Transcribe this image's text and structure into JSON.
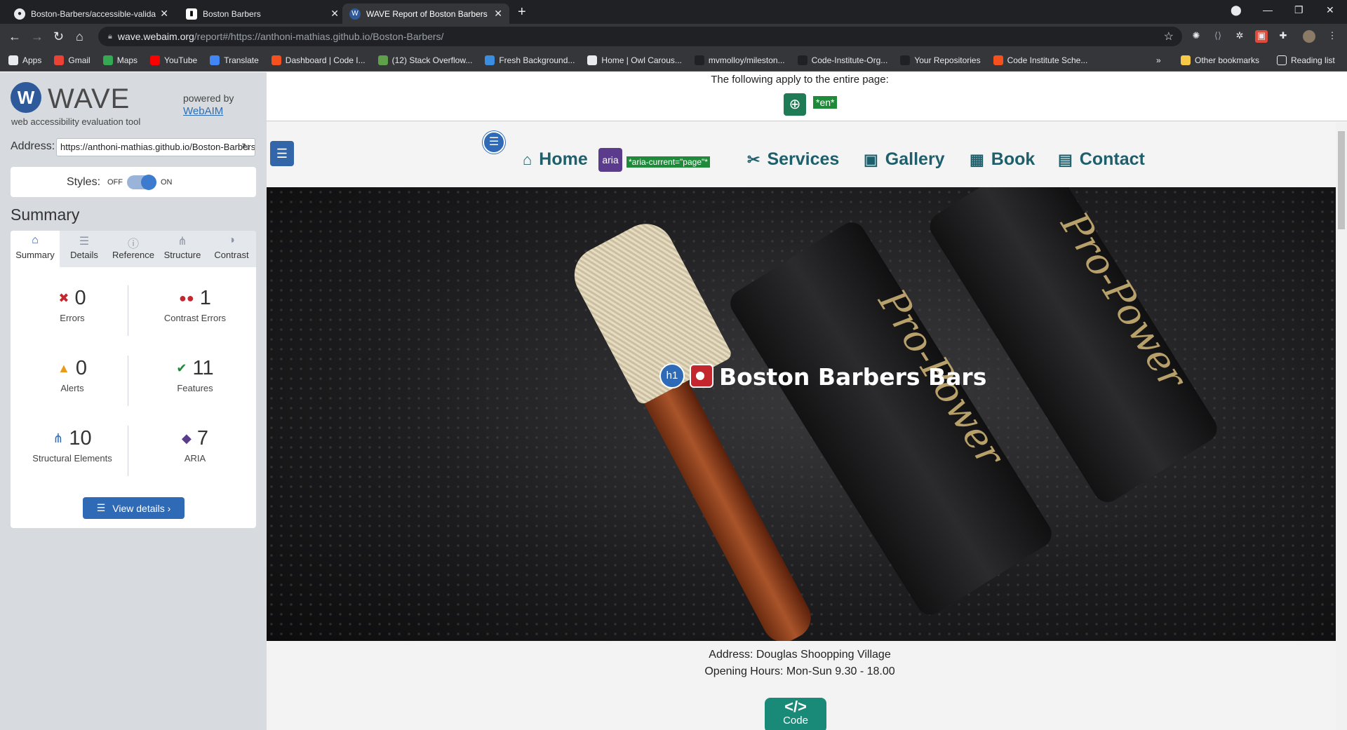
{
  "browser": {
    "tabs": [
      {
        "label": "Boston-Barbers/accessible-valida",
        "active": false
      },
      {
        "label": "Boston Barbers",
        "active": false
      },
      {
        "label": "WAVE Report of Boston Barbers",
        "active": true
      }
    ],
    "url_host": "wave.webaim.org",
    "url_path": "/report#/https://anthoni-mathias.github.io/Boston-Barbers/",
    "bookmarks": [
      {
        "label": "Apps",
        "color": "#e8eaed"
      },
      {
        "label": "Gmail",
        "color": "#ea4335"
      },
      {
        "label": "Maps",
        "color": "#34a853"
      },
      {
        "label": "YouTube",
        "color": "#ff0000"
      },
      {
        "label": "Translate",
        "color": "#4285f4"
      },
      {
        "label": "Dashboard | Code I...",
        "color": "#f4511e"
      },
      {
        "label": "(12) Stack Overflow...",
        "color": "#5fa14a"
      },
      {
        "label": "Fresh Background...",
        "color": "#3b8de0"
      },
      {
        "label": "Home | Owl Carous...",
        "color": "#e8eaed"
      },
      {
        "label": "mvmolloy/mileston...",
        "color": "#202124"
      },
      {
        "label": "Code-Institute-Org...",
        "color": "#202124"
      },
      {
        "label": "Your Repositories",
        "color": "#202124"
      },
      {
        "label": "Code Institute Sche...",
        "color": "#f4511e"
      }
    ],
    "bookmarks_more": "»",
    "other_bookmarks": "Other bookmarks",
    "reading_list": "Reading list"
  },
  "wave": {
    "logo_text": "WAVE",
    "subtitle": "web accessibility evaluation tool",
    "powered_by": "powered by",
    "webaim_link": "WebAIM",
    "address_label": "Address:",
    "address_value": "https://anthoni-mathias.github.io/Boston-Barbers/",
    "styles_label": "Styles:",
    "styles_off": "OFF",
    "styles_on": "ON",
    "styles_enabled": true,
    "summary_heading": "Summary",
    "tabs": [
      {
        "label": "Summary",
        "icon": "home-icon",
        "active": true
      },
      {
        "label": "Details",
        "icon": "list-icon",
        "active": false
      },
      {
        "label": "Reference",
        "icon": "info-icon",
        "active": false
      },
      {
        "label": "Structure",
        "icon": "structure-icon",
        "active": false
      },
      {
        "label": "Contrast",
        "icon": "contrast-icon",
        "active": false
      }
    ],
    "stats": [
      {
        "key": "errors",
        "count": "0",
        "label": "Errors",
        "icon": "error-icon",
        "color": "#c4262e"
      },
      {
        "key": "contrast",
        "count": "1",
        "label": "Contrast Errors",
        "icon": "contrast-error-icon",
        "color": "#c4262e"
      },
      {
        "key": "alerts",
        "count": "0",
        "label": "Alerts",
        "icon": "alert-icon",
        "color": "#e89a1a"
      },
      {
        "key": "features",
        "count": "11",
        "label": "Features",
        "icon": "feature-icon",
        "color": "#1e8a3a"
      },
      {
        "key": "structural",
        "count": "10",
        "label": "Structural Elements",
        "icon": "structure-icon",
        "color": "#2e6ab5"
      },
      {
        "key": "aria",
        "count": "7",
        "label": "ARIA",
        "icon": "aria-icon",
        "color": "#5b3c8c"
      }
    ],
    "view_details": "View details ›"
  },
  "preview": {
    "apply_text": "The following apply to the entire page:",
    "lang_tag": "*en*",
    "nav": [
      {
        "label": "Home",
        "icon": "home-icon"
      },
      {
        "label": "Services",
        "icon": "scissors-icon"
      },
      {
        "label": "Gallery",
        "icon": "image-icon"
      },
      {
        "label": "Book",
        "icon": "calendar-icon"
      },
      {
        "label": "Contact",
        "icon": "contact-icon"
      }
    ],
    "aria_badge": "aria",
    "aria_tag": "*aria-current=\"page\"*",
    "h1_badge": "h1",
    "hero_title": "Boston Barbers Bars",
    "clipper_text": "Pro-Power",
    "address_line": "Address: Douglas Shoopping Village",
    "hours_line": "Opening Hours: Mon-Sun 9.30 - 18.00",
    "code_badge": "Code"
  }
}
